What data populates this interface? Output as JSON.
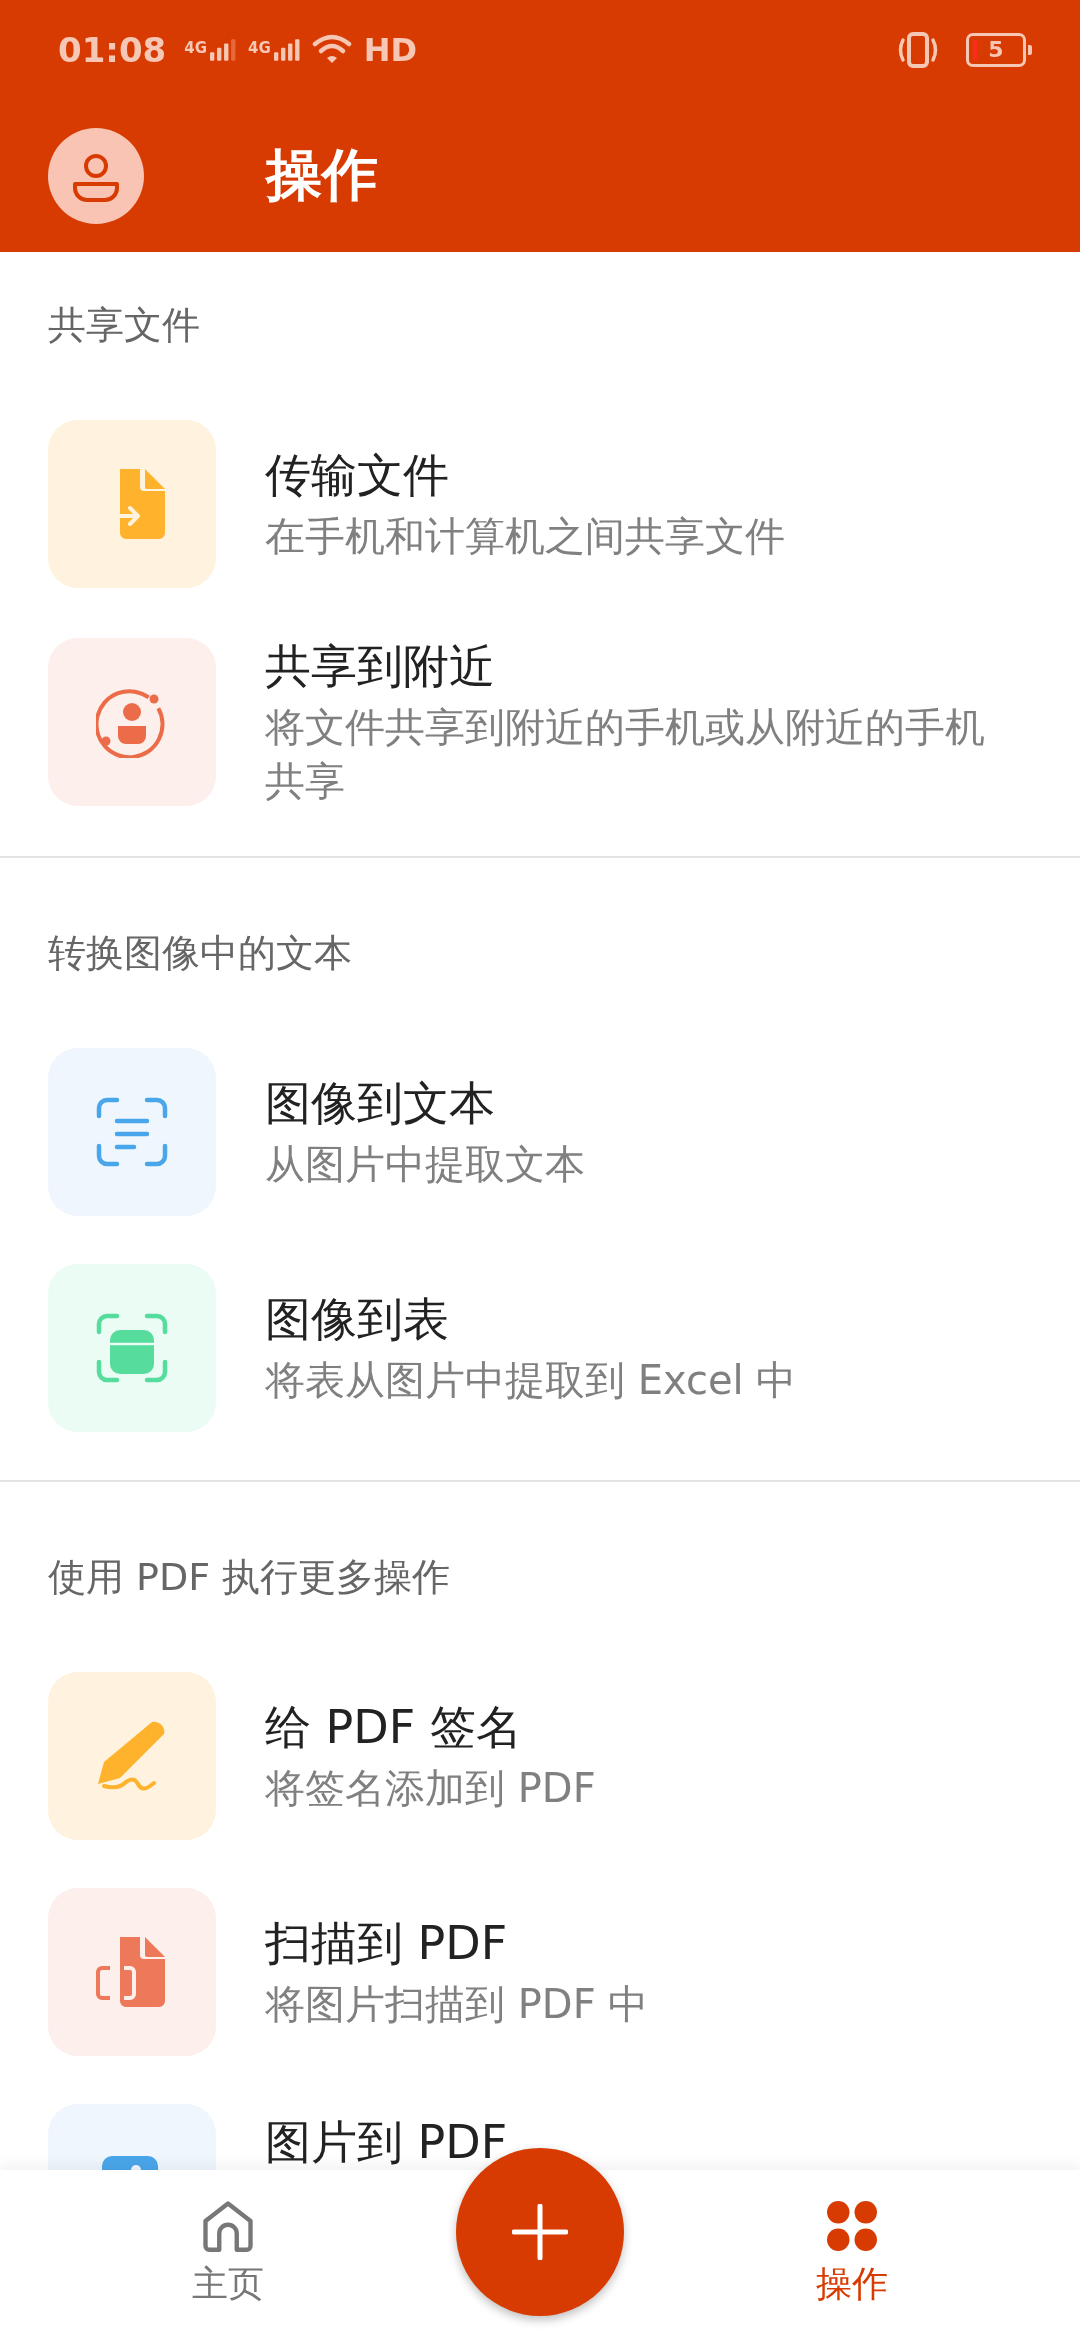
{
  "status_bar": {
    "time": "01:08",
    "networks": [
      "4G",
      "4G"
    ],
    "hd": "HD",
    "battery": "5"
  },
  "header": {
    "title": "操作"
  },
  "sections": [
    {
      "heading": "共享文件",
      "items": [
        {
          "kind": "transfer",
          "title": "传输文件",
          "subtitle": "在手机和计算机之间共享文件"
        },
        {
          "kind": "nearby",
          "title": "共享到附近",
          "subtitle": "将文件共享到附近的手机或从附近的手机共享"
        }
      ]
    },
    {
      "heading": "转换图像中的文本",
      "items": [
        {
          "kind": "image-text",
          "title": "图像到文本",
          "subtitle": "从图片中提取文本"
        },
        {
          "kind": "image-table",
          "title": "图像到表",
          "subtitle": "将表从图片中提取到 Excel 中"
        }
      ]
    },
    {
      "heading": "使用 PDF 执行更多操作",
      "items": [
        {
          "kind": "sign",
          "title": "给 PDF 签名",
          "subtitle": "将签名添加到 PDF"
        },
        {
          "kind": "scan",
          "title": "扫描到 PDF",
          "subtitle": "将图片扫描到 PDF 中"
        },
        {
          "kind": "image-pdf",
          "title": "图片到 PDF"
        }
      ]
    }
  ],
  "bottom_nav": [
    {
      "kind": "home",
      "label": "主页",
      "selected": false
    },
    {
      "kind": "grid",
      "label": "操作",
      "selected": true
    }
  ]
}
